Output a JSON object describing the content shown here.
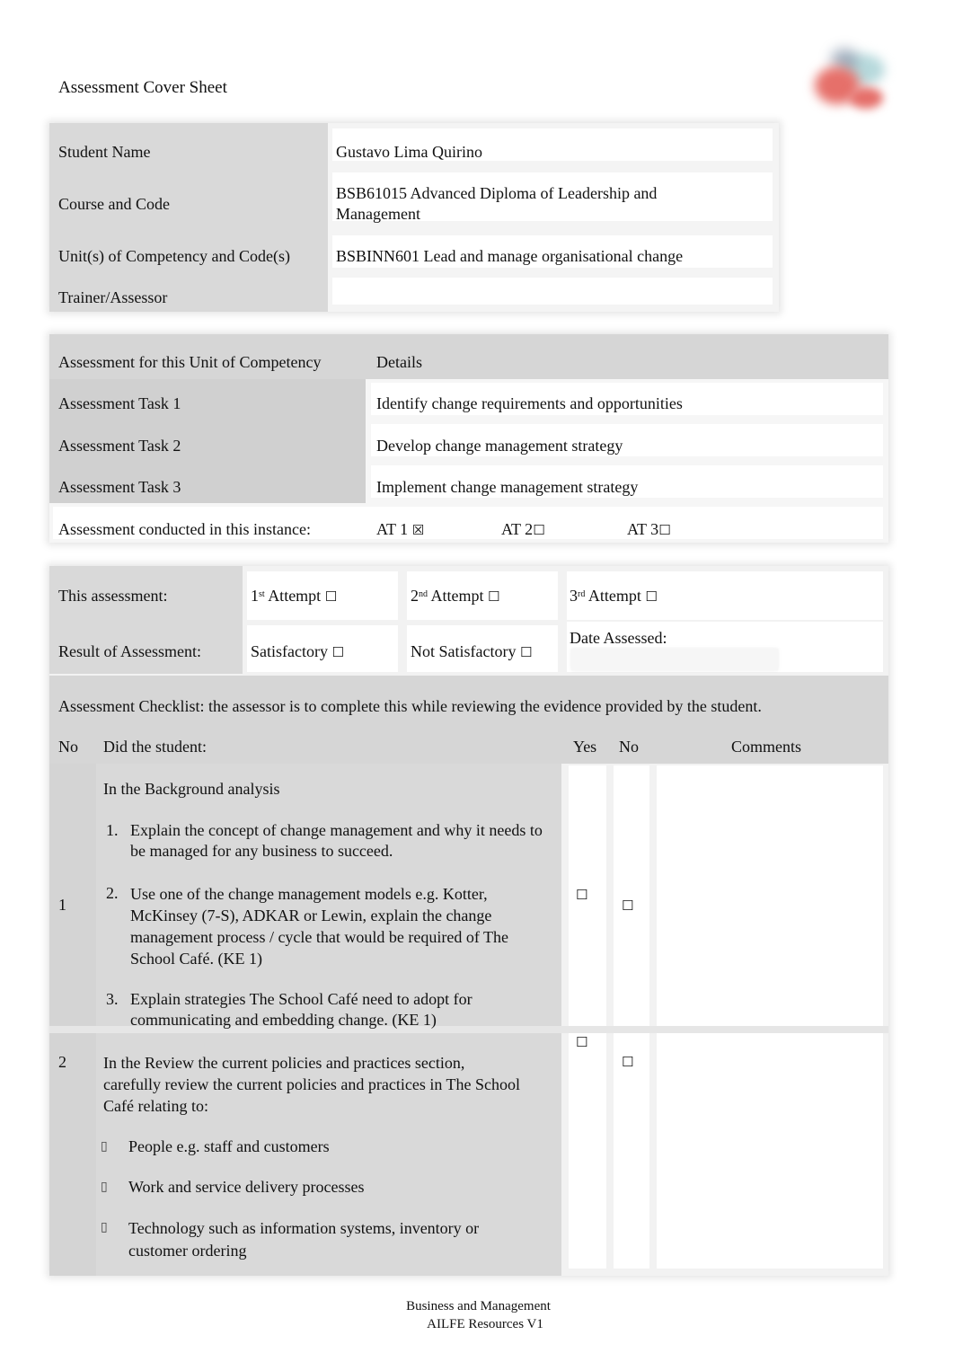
{
  "header": {
    "title": "Assessment Cover Sheet",
    "logo_icon": "organisation-logo-icon"
  },
  "student_info": {
    "rows": [
      {
        "label": "Student Name",
        "value": "Gustavo Lima Quirino"
      },
      {
        "label": "Course and Code",
        "value": "BSB61015 Advanced Diploma of Leadership and Management"
      },
      {
        "label": "Unit(s) of Competency and Code(s)",
        "value": "BSBINN601 Lead and manage organisational change"
      },
      {
        "label": "Trainer/Assessor",
        "value": ""
      }
    ]
  },
  "assessment_tasks": {
    "header_label": "Assessment for this Unit of Competency",
    "header_details": "Details",
    "tasks": [
      {
        "label": "Assessment Task 1",
        "details": "Identify change requirements and opportunities"
      },
      {
        "label": "Assessment Task 2",
        "details": "Develop change management strategy"
      },
      {
        "label": "Assessment Task 3",
        "details": "Implement change management strategy"
      }
    ],
    "conducted_label": "Assessment conducted in this instance:",
    "conducted_options": [
      {
        "label": "AT 1",
        "mark": "☒",
        "checked": true
      },
      {
        "label": "AT 2",
        "mark": "☐",
        "checked": false
      },
      {
        "label": "AT 3",
        "mark": "☐",
        "checked": false
      }
    ]
  },
  "attempt": {
    "label": "This assessment:",
    "options": [
      {
        "num": "1",
        "sup": "st",
        "text": "Attempt",
        "mark": "☐",
        "checked": false
      },
      {
        "num": "2",
        "sup": "nd",
        "text": "Attempt",
        "mark": "☐",
        "checked": false
      },
      {
        "num": "3",
        "sup": "rd",
        "text": "Attempt",
        "mark": "☐",
        "checked": false
      }
    ]
  },
  "result": {
    "label": "Result of Assessment:",
    "options": [
      {
        "text": "Satisfactory",
        "mark": "☐",
        "checked": false
      },
      {
        "text": "Not Satisfactory",
        "mark": "☐",
        "checked": false
      }
    ],
    "date_label": "Date Assessed:",
    "date_value": ""
  },
  "checklist": {
    "intro": "Assessment Checklist: the assessor is to complete this while reviewing the evidence provided by the student.",
    "columns": {
      "no": "No",
      "did": "Did the student:",
      "yes": "Yes",
      "no2": "No",
      "comments": "Comments"
    },
    "items": [
      {
        "no": "1",
        "intro": "In the Background analysis",
        "numbered": [
          {
            "n": "1.",
            "text": "Explain the concept of change management and why it needs to be managed for any business to succeed."
          },
          {
            "n": "2.",
            "text": "Use one of the change management models e.g. Kotter, McKinsey (7-S), ADKAR or Lewin, explain the change management process / cycle that would be required of The School Café. (KE 1)"
          },
          {
            "n": "3.",
            "text": "Explain strategies The School Café need to adopt for communicating and embedding change. (KE 1)"
          }
        ],
        "yes_mark": "☐",
        "no_mark": "☐",
        "comments": ""
      },
      {
        "no": "2",
        "intro": "In the Review the current policies and practices section, carefully review the current policies and practices in The School Café relating to:",
        "bullet_glyph": "▯",
        "bullets": [
          "People e.g. staff and customers",
          "Work and service delivery processes",
          "Technology such as information systems, inventory or customer ordering"
        ],
        "yes_mark": "☐",
        "no_mark": "☐",
        "comments": ""
      }
    ]
  },
  "footer": {
    "line1": "Business and Management",
    "line2": "AILFE Resources V1"
  }
}
